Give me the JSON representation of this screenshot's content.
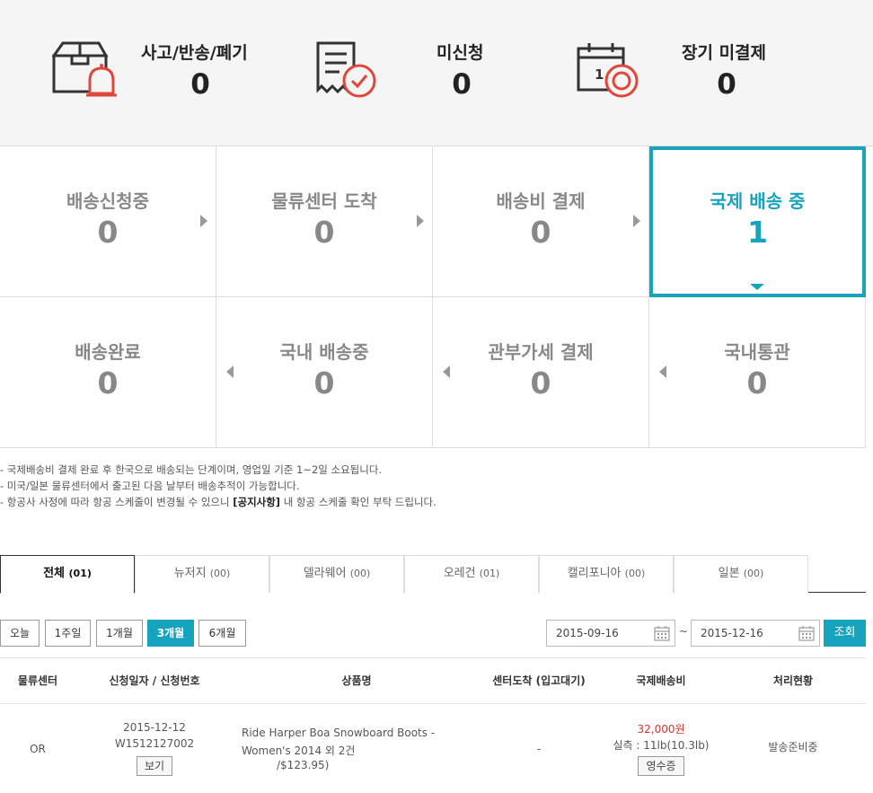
{
  "summary": {
    "accident": {
      "label": "사고/반송/폐기",
      "count": "0",
      "icon": "box-alarm-icon"
    },
    "unapplied": {
      "label": "미신청",
      "count": "0",
      "icon": "receipt-check-icon"
    },
    "long_unpaid": {
      "label": "장기 미결제",
      "count": "0",
      "icon": "calendar-target-icon"
    }
  },
  "statuses": [
    {
      "label": "배송신청중",
      "count": "0"
    },
    {
      "label": "물류센터 도착",
      "count": "0"
    },
    {
      "label": "배송비 결제",
      "count": "0"
    },
    {
      "label": "국제 배송 중",
      "count": "1",
      "active": true
    },
    {
      "label": "배송완료",
      "count": "0"
    },
    {
      "label": "국내 배송중",
      "count": "0"
    },
    {
      "label": "관부가세 결제",
      "count": "0"
    },
    {
      "label": "국내통관",
      "count": "0"
    }
  ],
  "notes": {
    "line1": "- 국제배송비 결제 완료 후 한국으로 배송되는 단계이며, 영업일 기준 1~2일 소요됩니다.",
    "line2": "- 미국/일본 물류센터에서 출고된 다음 날부터 배송추적이 가능합니다.",
    "line3_pre": "- 항공사 사정에 따라 항공 스케줄이 변경될 수 있으니 ",
    "line3_link": "[공지사항]",
    "line3_post": " 내 항공 스케줄 확인 부탁 드립니다."
  },
  "tabs": [
    {
      "label": "전체",
      "count": "(01)",
      "active": true
    },
    {
      "label": "뉴저지",
      "count": "(00)"
    },
    {
      "label": "델라웨어",
      "count": "(00)"
    },
    {
      "label": "오레건",
      "count": "(01)"
    },
    {
      "label": "캘리포니아",
      "count": "(00)"
    },
    {
      "label": "일본",
      "count": "(00)"
    }
  ],
  "periods": [
    "오늘",
    "1주일",
    "1개월",
    "3개월",
    "6개월"
  ],
  "period_selected": "3개월",
  "date_from": "2015-09-16",
  "date_to": "2015-12-16",
  "date_sep": "~",
  "search_label": "조회",
  "table": {
    "headers": [
      "물류센터",
      "신청일자 / 신청번호",
      "상품명",
      "센터도착 (입고대기)",
      "국제배송비",
      "처리현황"
    ],
    "row": {
      "center": "OR",
      "date": "2015-12-12",
      "order_no": "W1512127002",
      "view_label": "보기",
      "product_line1": "Ride Harper Boa Snowboard Boots -",
      "product_line2": "Women's 2014 외 2건",
      "product_price": "/$123.95)",
      "arrival": "-",
      "fee": "32,000원",
      "weight": "실측 : 11lb(10.3lb)",
      "receipt_label": "영수증",
      "status": "발송준비중"
    }
  },
  "colors": {
    "accent": "#16a3bd",
    "alert": "#e0463a",
    "fee": "#d9342b"
  }
}
